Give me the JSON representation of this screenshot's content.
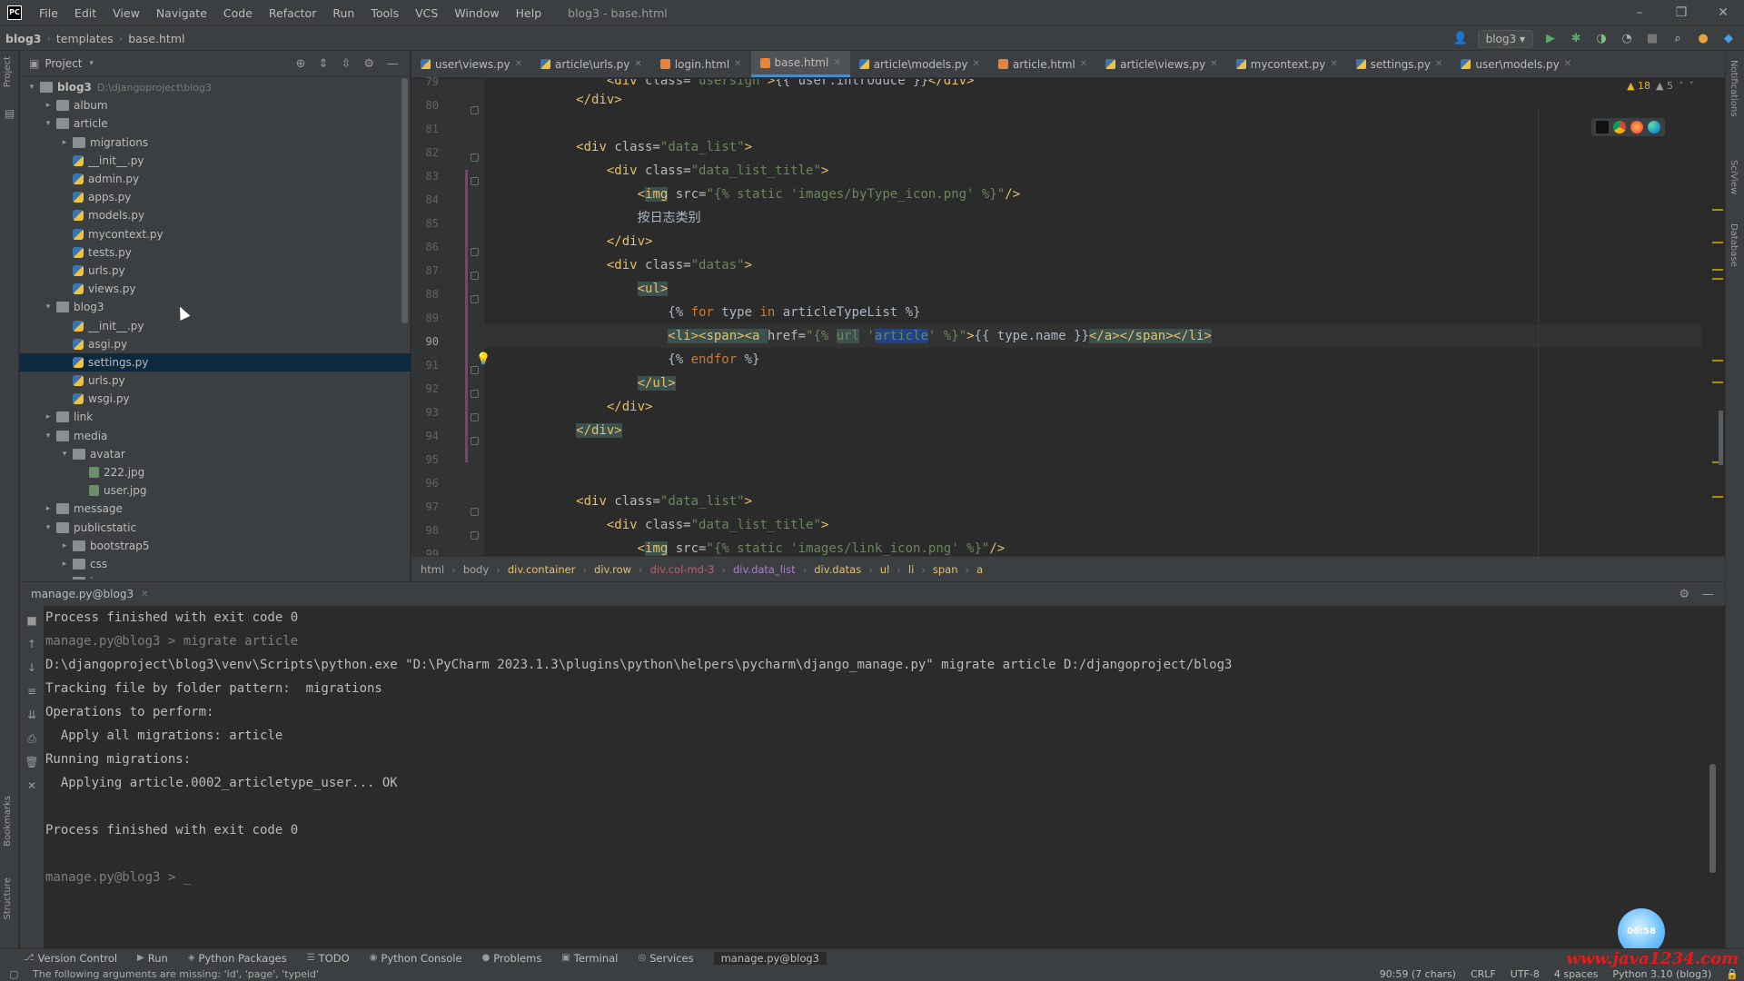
{
  "menubar": {
    "items": [
      "File",
      "Edit",
      "View",
      "Navigate",
      "Code",
      "Refactor",
      "Run",
      "Tools",
      "VCS",
      "Window",
      "Help"
    ],
    "window_title": "blog3 - base.html",
    "window_controls": [
      "–",
      "❐",
      "✕"
    ]
  },
  "navbar": {
    "crumbs": [
      "blog3",
      "templates",
      "base.html"
    ],
    "run_config": "blog3"
  },
  "project": {
    "title": "Project",
    "tree": [
      {
        "label": "blog3",
        "hint": "D:\\djangoproject\\blog3",
        "type": "folder",
        "indent": 0,
        "arrow": "▾",
        "bold": true
      },
      {
        "label": "album",
        "type": "folder",
        "indent": 1,
        "arrow": "▸"
      },
      {
        "label": "article",
        "type": "folder",
        "indent": 1,
        "arrow": "▾"
      },
      {
        "label": "migrations",
        "type": "folder",
        "indent": 2,
        "arrow": "▸"
      },
      {
        "label": "__init__.py",
        "type": "py",
        "indent": 2,
        "arrow": ""
      },
      {
        "label": "admin.py",
        "type": "py",
        "indent": 2,
        "arrow": ""
      },
      {
        "label": "apps.py",
        "type": "py",
        "indent": 2,
        "arrow": ""
      },
      {
        "label": "models.py",
        "type": "py",
        "indent": 2,
        "arrow": ""
      },
      {
        "label": "mycontext.py",
        "type": "py",
        "indent": 2,
        "arrow": ""
      },
      {
        "label": "tests.py",
        "type": "py",
        "indent": 2,
        "arrow": ""
      },
      {
        "label": "urls.py",
        "type": "py",
        "indent": 2,
        "arrow": ""
      },
      {
        "label": "views.py",
        "type": "py",
        "indent": 2,
        "arrow": ""
      },
      {
        "label": "blog3",
        "type": "folder",
        "indent": 1,
        "arrow": "▾"
      },
      {
        "label": "__init__.py",
        "type": "py",
        "indent": 2,
        "arrow": ""
      },
      {
        "label": "asgi.py",
        "type": "py",
        "indent": 2,
        "arrow": ""
      },
      {
        "label": "settings.py",
        "type": "py",
        "indent": 2,
        "arrow": "",
        "selected": true
      },
      {
        "label": "urls.py",
        "type": "py",
        "indent": 2,
        "arrow": ""
      },
      {
        "label": "wsgi.py",
        "type": "py",
        "indent": 2,
        "arrow": ""
      },
      {
        "label": "link",
        "type": "folder",
        "indent": 1,
        "arrow": "▸"
      },
      {
        "label": "media",
        "type": "folder",
        "indent": 1,
        "arrow": "▾"
      },
      {
        "label": "avatar",
        "type": "folder",
        "indent": 2,
        "arrow": "▾"
      },
      {
        "label": "222.jpg",
        "type": "img",
        "indent": 3,
        "arrow": ""
      },
      {
        "label": "user.jpg",
        "type": "img",
        "indent": 3,
        "arrow": ""
      },
      {
        "label": "message",
        "type": "folder",
        "indent": 1,
        "arrow": "▸"
      },
      {
        "label": "publicstatic",
        "type": "folder",
        "indent": 1,
        "arrow": "▾"
      },
      {
        "label": "bootstrap5",
        "type": "folder",
        "indent": 2,
        "arrow": "▸"
      },
      {
        "label": "css",
        "type": "folder",
        "indent": 2,
        "arrow": "▸"
      },
      {
        "label": "images",
        "type": "folder",
        "indent": 2,
        "arrow": "▸"
      }
    ]
  },
  "editor": {
    "tabs": [
      {
        "label": "user\\views.py",
        "type": "py"
      },
      {
        "label": "article\\urls.py",
        "type": "py"
      },
      {
        "label": "login.html",
        "type": "html"
      },
      {
        "label": "base.html",
        "type": "html",
        "active": true
      },
      {
        "label": "article\\models.py",
        "type": "py"
      },
      {
        "label": "article.html",
        "type": "html"
      },
      {
        "label": "article\\views.py",
        "type": "py"
      },
      {
        "label": "mycontext.py",
        "type": "py"
      },
      {
        "label": "settings.py",
        "type": "py"
      },
      {
        "label": "user\\models.py",
        "type": "py"
      }
    ],
    "inspection": {
      "warnings": "▲ 18",
      "weak": "▲ 5"
    },
    "line_numbers": [
      "79",
      "80",
      "81",
      "82",
      "83",
      "84",
      "85",
      "86",
      "87",
      "88",
      "89",
      "90",
      "91",
      "92",
      "93",
      "94",
      "95",
      "96",
      "97",
      "98",
      "99"
    ],
    "current_line": "90",
    "breadcrumb": [
      "html",
      "body",
      "div.container",
      "div.row",
      "div.col-md-3",
      "div.data_list",
      "div.datas",
      "ul",
      "li",
      "span",
      "a"
    ]
  },
  "console": {
    "tab_label": "manage.py@blog3",
    "lines": [
      {
        "text": "Process finished with exit code 0",
        "kind": "normal"
      },
      {
        "text": "manage.py@blog3 > migrate article",
        "kind": "cmd"
      },
      {
        "text": "D:\\djangoproject\\blog3\\venv\\Scripts\\python.exe \"D:\\PyCharm 2023.1.3\\plugins\\python\\helpers\\pycharm\\django_manage.py\" migrate article D:/djangoproject/blog3",
        "kind": "normal"
      },
      {
        "text": "Tracking file by folder pattern:  migrations",
        "kind": "normal"
      },
      {
        "text": "Operations to perform:",
        "kind": "normal"
      },
      {
        "text": "  Apply all migrations: article",
        "kind": "normal"
      },
      {
        "text": "Running migrations:",
        "kind": "normal"
      },
      {
        "text": "  Applying article.0002_articletype_user... OK",
        "kind": "normal"
      },
      {
        "text": "",
        "kind": "normal"
      },
      {
        "text": "Process finished with exit code 0",
        "kind": "normal"
      },
      {
        "text": "",
        "kind": "normal"
      },
      {
        "text": "manage.py@blog3 > ",
        "kind": "prompt"
      }
    ]
  },
  "toolwindows": [
    {
      "label": "Version Control",
      "glyph": "⎇"
    },
    {
      "label": "Run",
      "glyph": "▶"
    },
    {
      "label": "Python Packages",
      "glyph": "◈"
    },
    {
      "label": "TODO",
      "glyph": "☰"
    },
    {
      "label": "Python Console",
      "glyph": "◉"
    },
    {
      "label": "Problems",
      "glyph": "●"
    },
    {
      "label": "Terminal",
      "glyph": "▣"
    },
    {
      "label": "Services",
      "glyph": "◎"
    },
    {
      "label": "manage.py@blog3",
      "glyph": "",
      "active": true
    }
  ],
  "status": {
    "message": "The following arguments are missing: 'id', 'page', 'typeid'",
    "position": "90:59 (7 chars)",
    "line_sep": "CRLF",
    "encoding": "UTF-8",
    "indent": "4 spaces",
    "interpreter": "Python 3.10 (blog3)"
  },
  "watermark": "www.java1234.com",
  "avatar_label": "06:58"
}
